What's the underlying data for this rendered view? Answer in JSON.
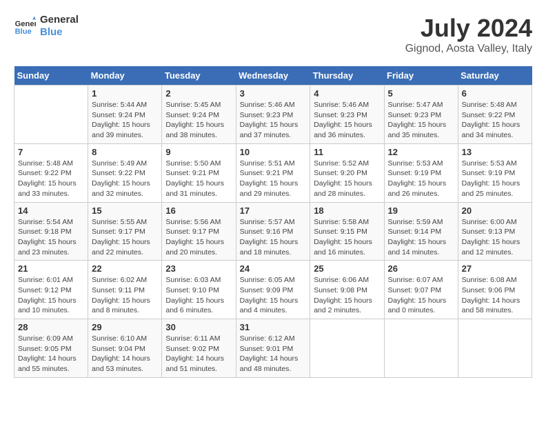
{
  "logo": {
    "line1": "General",
    "line2": "Blue"
  },
  "title": "July 2024",
  "location": "Gignod, Aosta Valley, Italy",
  "days_of_week": [
    "Sunday",
    "Monday",
    "Tuesday",
    "Wednesday",
    "Thursday",
    "Friday",
    "Saturday"
  ],
  "weeks": [
    [
      {
        "day": "",
        "info": ""
      },
      {
        "day": "1",
        "info": "Sunrise: 5:44 AM\nSunset: 9:24 PM\nDaylight: 15 hours\nand 39 minutes."
      },
      {
        "day": "2",
        "info": "Sunrise: 5:45 AM\nSunset: 9:24 PM\nDaylight: 15 hours\nand 38 minutes."
      },
      {
        "day": "3",
        "info": "Sunrise: 5:46 AM\nSunset: 9:23 PM\nDaylight: 15 hours\nand 37 minutes."
      },
      {
        "day": "4",
        "info": "Sunrise: 5:46 AM\nSunset: 9:23 PM\nDaylight: 15 hours\nand 36 minutes."
      },
      {
        "day": "5",
        "info": "Sunrise: 5:47 AM\nSunset: 9:23 PM\nDaylight: 15 hours\nand 35 minutes."
      },
      {
        "day": "6",
        "info": "Sunrise: 5:48 AM\nSunset: 9:22 PM\nDaylight: 15 hours\nand 34 minutes."
      }
    ],
    [
      {
        "day": "7",
        "info": "Sunrise: 5:48 AM\nSunset: 9:22 PM\nDaylight: 15 hours\nand 33 minutes."
      },
      {
        "day": "8",
        "info": "Sunrise: 5:49 AM\nSunset: 9:22 PM\nDaylight: 15 hours\nand 32 minutes."
      },
      {
        "day": "9",
        "info": "Sunrise: 5:50 AM\nSunset: 9:21 PM\nDaylight: 15 hours\nand 31 minutes."
      },
      {
        "day": "10",
        "info": "Sunrise: 5:51 AM\nSunset: 9:21 PM\nDaylight: 15 hours\nand 29 minutes."
      },
      {
        "day": "11",
        "info": "Sunrise: 5:52 AM\nSunset: 9:20 PM\nDaylight: 15 hours\nand 28 minutes."
      },
      {
        "day": "12",
        "info": "Sunrise: 5:53 AM\nSunset: 9:19 PM\nDaylight: 15 hours\nand 26 minutes."
      },
      {
        "day": "13",
        "info": "Sunrise: 5:53 AM\nSunset: 9:19 PM\nDaylight: 15 hours\nand 25 minutes."
      }
    ],
    [
      {
        "day": "14",
        "info": "Sunrise: 5:54 AM\nSunset: 9:18 PM\nDaylight: 15 hours\nand 23 minutes."
      },
      {
        "day": "15",
        "info": "Sunrise: 5:55 AM\nSunset: 9:17 PM\nDaylight: 15 hours\nand 22 minutes."
      },
      {
        "day": "16",
        "info": "Sunrise: 5:56 AM\nSunset: 9:17 PM\nDaylight: 15 hours\nand 20 minutes."
      },
      {
        "day": "17",
        "info": "Sunrise: 5:57 AM\nSunset: 9:16 PM\nDaylight: 15 hours\nand 18 minutes."
      },
      {
        "day": "18",
        "info": "Sunrise: 5:58 AM\nSunset: 9:15 PM\nDaylight: 15 hours\nand 16 minutes."
      },
      {
        "day": "19",
        "info": "Sunrise: 5:59 AM\nSunset: 9:14 PM\nDaylight: 15 hours\nand 14 minutes."
      },
      {
        "day": "20",
        "info": "Sunrise: 6:00 AM\nSunset: 9:13 PM\nDaylight: 15 hours\nand 12 minutes."
      }
    ],
    [
      {
        "day": "21",
        "info": "Sunrise: 6:01 AM\nSunset: 9:12 PM\nDaylight: 15 hours\nand 10 minutes."
      },
      {
        "day": "22",
        "info": "Sunrise: 6:02 AM\nSunset: 9:11 PM\nDaylight: 15 hours\nand 8 minutes."
      },
      {
        "day": "23",
        "info": "Sunrise: 6:03 AM\nSunset: 9:10 PM\nDaylight: 15 hours\nand 6 minutes."
      },
      {
        "day": "24",
        "info": "Sunrise: 6:05 AM\nSunset: 9:09 PM\nDaylight: 15 hours\nand 4 minutes."
      },
      {
        "day": "25",
        "info": "Sunrise: 6:06 AM\nSunset: 9:08 PM\nDaylight: 15 hours\nand 2 minutes."
      },
      {
        "day": "26",
        "info": "Sunrise: 6:07 AM\nSunset: 9:07 PM\nDaylight: 15 hours\nand 0 minutes."
      },
      {
        "day": "27",
        "info": "Sunrise: 6:08 AM\nSunset: 9:06 PM\nDaylight: 14 hours\nand 58 minutes."
      }
    ],
    [
      {
        "day": "28",
        "info": "Sunrise: 6:09 AM\nSunset: 9:05 PM\nDaylight: 14 hours\nand 55 minutes."
      },
      {
        "day": "29",
        "info": "Sunrise: 6:10 AM\nSunset: 9:04 PM\nDaylight: 14 hours\nand 53 minutes."
      },
      {
        "day": "30",
        "info": "Sunrise: 6:11 AM\nSunset: 9:02 PM\nDaylight: 14 hours\nand 51 minutes."
      },
      {
        "day": "31",
        "info": "Sunrise: 6:12 AM\nSunset: 9:01 PM\nDaylight: 14 hours\nand 48 minutes."
      },
      {
        "day": "",
        "info": ""
      },
      {
        "day": "",
        "info": ""
      },
      {
        "day": "",
        "info": ""
      }
    ]
  ]
}
